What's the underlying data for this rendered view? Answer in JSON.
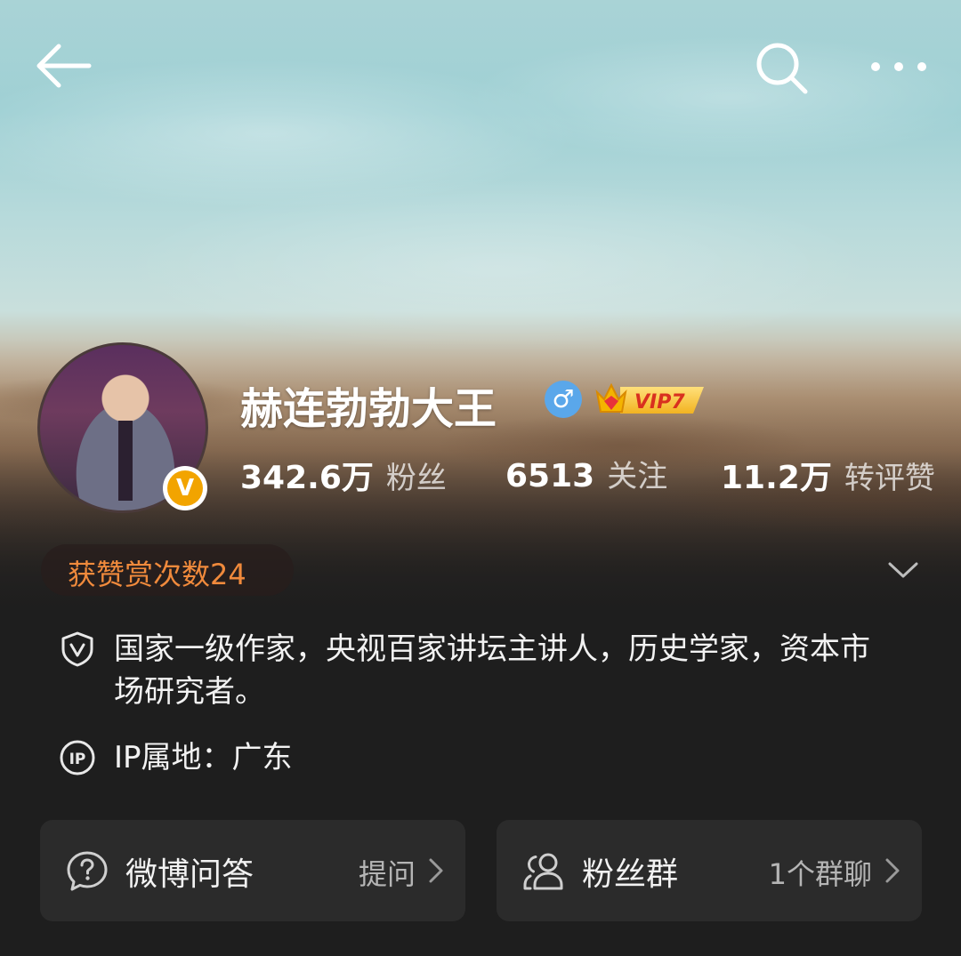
{
  "profile": {
    "username": "赫连勃勃大王",
    "vip_label": "VIP7",
    "verified_mark": "V",
    "gender_symbol": "♂",
    "stats": [
      {
        "value": "342.6万",
        "label": "粉丝"
      },
      {
        "value": "6513",
        "label": "关注"
      },
      {
        "value": "11.2万",
        "label": "转评赞"
      }
    ],
    "reward_text": "获赞赏次数24",
    "bio": "国家一级作家，央视百家讲坛主讲人，历史学家，资本市场研究者。",
    "ip_location": "IP属地：广东"
  },
  "cards": [
    {
      "title": "微博问答",
      "action": "提问",
      "icon": "question-bubble-icon"
    },
    {
      "title": "粉丝群",
      "action": "1个群聊",
      "icon": "group-users-icon"
    }
  ],
  "colors": {
    "accent_orange": "#f08a3c",
    "vip_gold": "#f2b321",
    "verified_orange": "#f2a400",
    "gender_blue": "#5aa7ea",
    "card_bg": "#2b2b2b",
    "page_bg": "#1e1e1e"
  },
  "icons": {
    "back": "back-arrow-icon",
    "search": "search-icon",
    "more": "more-dots-icon",
    "expand": "chevron-down-icon",
    "bio": "shield-v-icon",
    "ip": "ip-icon"
  }
}
